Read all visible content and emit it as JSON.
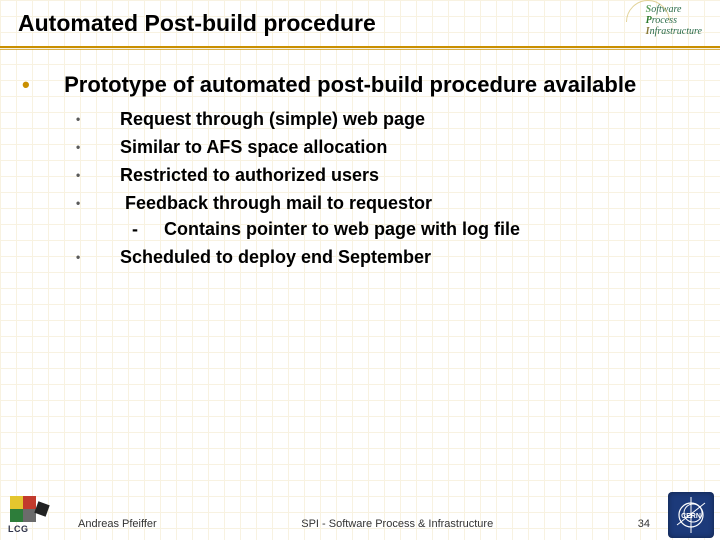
{
  "header": {
    "title": "Automated Post-build procedure",
    "spi_logo": {
      "line1_initial": "S",
      "line1_rest": "oftware",
      "line2_initial": "P",
      "line2_rest": "rocess",
      "line3_initial": "I",
      "line3_rest": "nfrastructure"
    }
  },
  "content": {
    "main_bullet": "Prototype of automated post-build procedure available",
    "sub_bullets": [
      "Request through (simple) web page",
      "Similar to AFS space allocation",
      "Restricted to authorized users",
      "Feedback through mail to requestor",
      "Scheduled to deploy end September"
    ],
    "sub_sub_bullet": "Contains pointer to web page with log file"
  },
  "footer": {
    "author": "Andreas Pfeiffer",
    "center": "SPI - Software Process & Infrastructure",
    "page": "34",
    "lcg_label": "LCG",
    "cern_label": "CERN"
  },
  "colors": {
    "accent": "#c98f00",
    "cern_bg": "#1c3a7a"
  }
}
